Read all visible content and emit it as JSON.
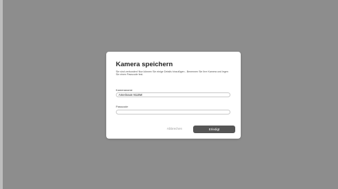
{
  "dialog": {
    "title": "Kamera speichern",
    "description": "Sie sind verbunden! Nun können Sie einige Details hinzufügen - Benennen Sie Ihre Kamera und legen Sie einen Passcode fest.",
    "camera_name_label": "Kameraname",
    "camera_name_value": "Amerinaon 9115W",
    "passcode_label": "Passcode",
    "passcode_value": "",
    "cancel_label": "Abbrechen",
    "done_label": "Erledigt"
  },
  "colors": {
    "backdrop": "#8d8d8d",
    "dialog_bg": "#ffffff",
    "primary_button": "#555555",
    "cancel_text": "#9a9a9a"
  }
}
